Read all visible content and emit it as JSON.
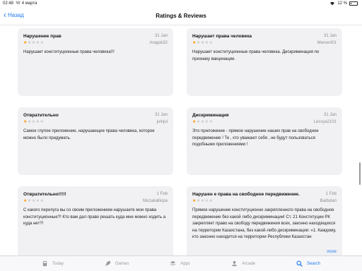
{
  "status_bar": {
    "time": "02:48",
    "date": "Чт 4 марта",
    "battery": "12 %"
  },
  "nav": {
    "back_label": "Назад",
    "title": "Ratings & Reviews"
  },
  "reviews": [
    {
      "title": "Нарушение прав",
      "date": "31 Jan",
      "author": "Aragok32",
      "stars": 1,
      "body": "Нарушает конституционные права человека!!!"
    },
    {
      "title": "Нарушает права человека",
      "date": "31 Jan",
      "author": "Meruert01",
      "stars": 1,
      "body": "Нарушает конституционные права человека. Дискриминация по признаку вакцинации."
    },
    {
      "title": "Отвратительно",
      "date": "31 Jan",
      "author": "julnjul",
      "stars": 1,
      "body": "Самое глупое приложение, нарушающее права человека, которое можно было придумать."
    },
    {
      "title": "Дискриминация",
      "date": "31 Jan",
      "author": "Lessya2101",
      "stars": 1,
      "body": "Это приложение - прямое нарушение наших прав на свободное передвижение ! Те , кто уважают себя , не будут пользоваться подобными приложениями !"
    },
    {
      "title": "Отвратительно!!!!!",
      "date": "1 Feb",
      "author": "Muzakalliopa",
      "stars": 1,
      "body": "С какого перепуга вы со своим приложением нарушаете мои права конституционные?! Кто вам дал право решать куда мне можно ходить а куда нет?!"
    },
    {
      "title": "Нарушен е права на свободное передвижение.",
      "date": "1 Feb",
      "author": "Baibulan",
      "stars": 1,
      "body": "Прямое нарушение конституционно закрепленного права на свободное передвижение без какой либо дискриминации! Ст. 21 Конституции РК закрепляет право на свободу передвижения всех, законно находящихся на территории Казахстана, без какой-либо дискриминации: «1. Каждому, кто законно находится на территории Республики Казахстан",
      "more_label": "more"
    }
  ],
  "tabs": [
    {
      "label": "Today",
      "icon": "today-icon",
      "active": false
    },
    {
      "label": "Games",
      "icon": "games-rocket-icon",
      "active": false
    },
    {
      "label": "Apps",
      "icon": "apps-stack-icon",
      "active": false
    },
    {
      "label": "Arcade",
      "icon": "arcade-joystick-icon",
      "active": false
    },
    {
      "label": "Search",
      "icon": "search-icon",
      "active": true
    }
  ],
  "colors": {
    "accent": "#1f7aec",
    "star": "#ff9500",
    "card_bg": "#f1f1f4"
  }
}
